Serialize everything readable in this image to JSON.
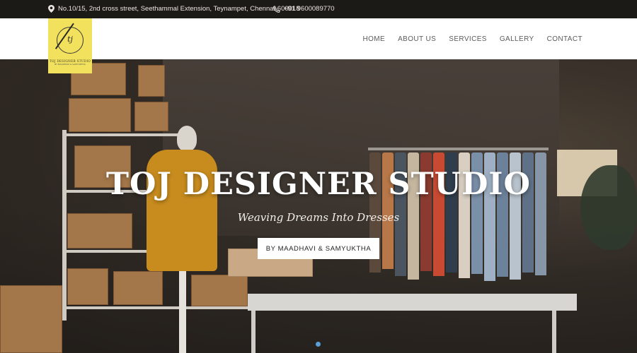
{
  "topbar": {
    "address": "No.10/15, 2nd cross street, Seethammal Extension, Teynampet, Chennai-600018",
    "phone": "+91 9600089770",
    "icons": {
      "address": "map-pin-icon",
      "phone": "phone-icon"
    }
  },
  "logo": {
    "monogram": "tj",
    "name": "TOJ DESIGNER STUDIO",
    "tagline": "BY MAADHAVI & SAMYUKTHA"
  },
  "nav": {
    "items": [
      "HOME",
      "ABOUT US",
      "SERVICES",
      "GALLERY",
      "CONTACT"
    ]
  },
  "hero": {
    "title": "TOJ DESIGNER STUDIO",
    "subtitle": "Weaving Dreams Into Dresses",
    "cta_label": "BY MAADHAVI & SAMYUKTHA"
  },
  "colors": {
    "topbar_bg": "#1c1a17",
    "logo_bg": "#f2e15c",
    "slider_dot": "#5aa0d8"
  }
}
